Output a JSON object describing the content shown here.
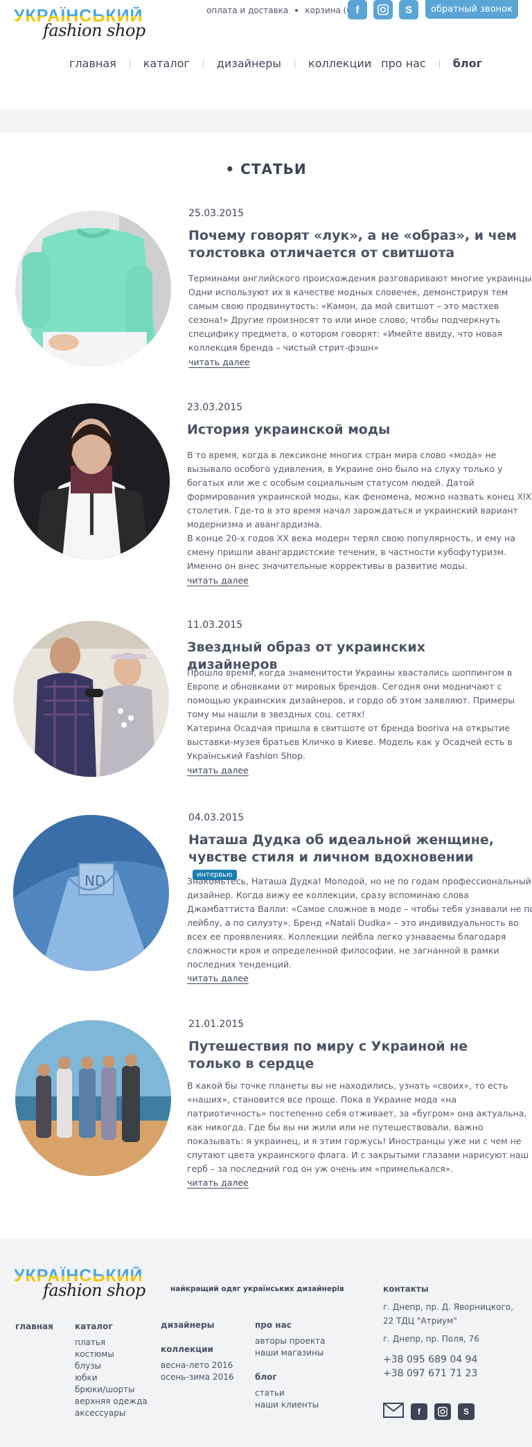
{
  "header": {
    "logo_top": "УКРАЇНСЬКИЙ",
    "logo_bottom": "fashion shop",
    "delivery_link": "оплата и доставка",
    "cart_link": "корзина (0)",
    "callback_button": "обратный звонок",
    "social": {
      "facebook": "f",
      "instagram": "◙",
      "skype": "S"
    }
  },
  "nav": [
    "главная",
    "каталог",
    "дизайнеры",
    "коллекции",
    "про нас",
    "блог"
  ],
  "section_title": "• СТАТЬИ",
  "articles": [
    {
      "date": "25.03.2015",
      "title": "Почему говорят «лук», а не «образ», и чем толстовка отличается от свитшота",
      "text": "Терминами английского происхождения разговаривают многие украинцы. Одни используют их в качестве модных словечек, демонстрируя тем самым свою продвинутость: «Камон, да мой свитшот – это мастхев сезона!» Другие произносят то или иное слово, чтобы подчеркнуть специфику предмета, о котором говорят: «Имейте ввиду, что новая коллекция бренда – чистый стрит-фэшн»",
      "more": "читать далее"
    },
    {
      "date": "23.03.2015",
      "title": "История украинской моды",
      "text": "В то время, когда в лексиконе многих стран мира слово «мода» не вызывало особого удивления, в Украине оно было на слуху только у богатых или же с особым социальным статусом людей. Датой формирования украинской моды, как феномена, можно назвать конец XIX столетия. Где-то в это время начал зарождаться и украинский вариант модернизма и авангардизма.",
      "text2": "В конце 20-х годов XX века модерн терял свою популярность, и ему на смену пришли авангардистские течения, в частности кубофутуризм. Именно он внес значительные коррективы в развитие моды.",
      "more": "читать далее"
    },
    {
      "date": "11.03.2015",
      "title": "Звездный образ от украинских дизайнеров",
      "text": "Прошло время, когда знаменитости Украины хвастались шоппингом в Европе и обновками от мировых брендов. Сегодня они модничают с помощью украинских дизайнеров, и гордо об этом заявляют. Примеры тому мы нашли в звездных соц. сетях!",
      "text2": "Катерина Осадчая пришла в свитшоте от бренда booriva на открытие выставки-музея братьев Кличко в Киеве. Модель как у Осадчей есть в Український Fashion Shop.",
      "more": "читать далее"
    },
    {
      "date": "04.03.2015",
      "title": "Наташа Дудка об идеальной женщине, чувстве стиля и личном вдохновении",
      "badge": "интервью",
      "text": "Знакомьтесь, Наташа Дудка! Молодой, но не по годам профессиональный дизайнер. Когда вижу ее коллекции, сразу вспоминаю слова Джамбаттиста Валли: «Самое сложное в моде – чтобы тебя узнавали не по лейблу, а по силуэту». Бренд «Natali Dudka» – это индивидуальность во всех ее проявлениях. Коллекции лейбла легко узнаваемы благодаря сложности кроя и определенной философии, не загнанной в рамки последних тенденций.",
      "more": "читать далее"
    },
    {
      "date": "21.01.2015",
      "title": "Путешествия по миру с Украиной не только в сердце",
      "text": "В какой бы точке планеты вы не находились, узнать «своих», то есть «наших», становится все проще. Пока в Украине мода «на патриотичность» постепенно себя отживает, за «бугром» она актуальна, как никогда. Где бы вы ни жили или не путешествовали, важно показывать: я украинец, и я этим горжусь! Иностранцы уже ни с чем не спутают цвета украинского флага. И с закрытыми глазами нарисуют наш герб – за последний год он уж очень им «примелькался».",
      "more": "читать далее"
    }
  ],
  "footer": {
    "tagline": "найкращий одяг українських дизайнерів",
    "home": "главная",
    "catalog_title": "каталог",
    "catalog": [
      "платья",
      "костюмы",
      "блузы",
      "юбки",
      "брюки/шорты",
      "верхняя одежда",
      "аксессуары"
    ],
    "designers": "дизайнеры",
    "collections_title": "коллекции",
    "collections": [
      "весна-лето 2016",
      "осень-зима 2016"
    ],
    "about_title": "про нас",
    "about": [
      "авторы проекта",
      "наши магазины"
    ],
    "blog_title": "блог",
    "blog": [
      "статьи",
      "наши клиенты"
    ],
    "contacts_title": "контакты",
    "address1": "г. Днепр, пр. Д. Яворницкого, 22 ТДЦ \"Атриум\"",
    "address2": "г. Днепр, пр. Поля, 76",
    "phone1": "+38 095 689 04 94",
    "phone2": "+38 097 671 71 23"
  }
}
